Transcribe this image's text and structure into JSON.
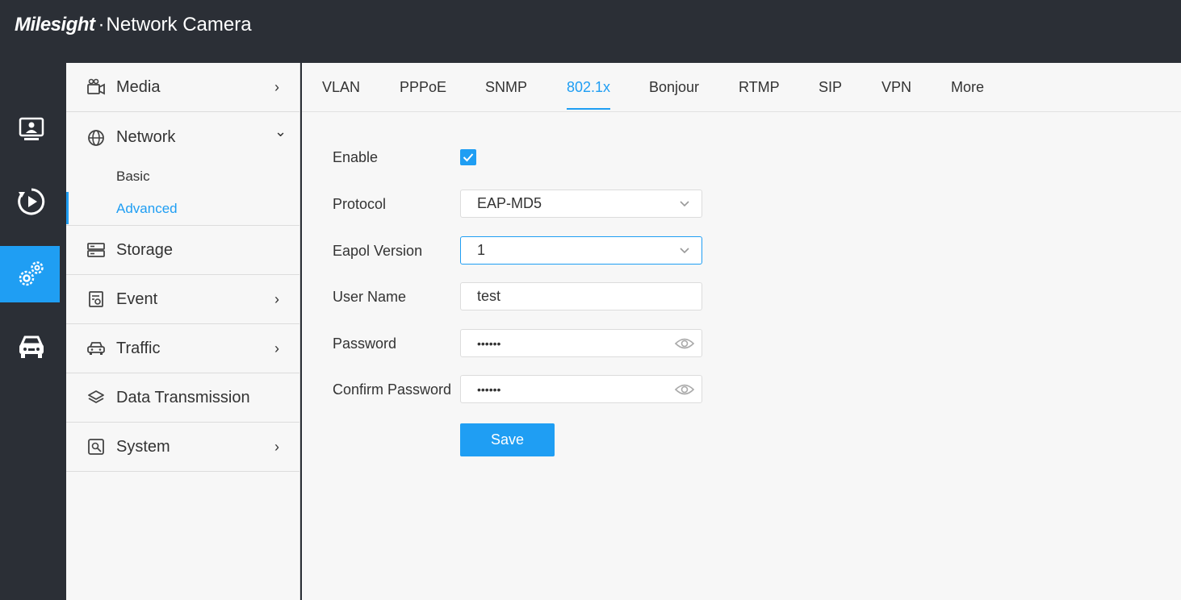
{
  "header": {
    "brand": "Milesight",
    "separator": "·",
    "product": "Network Camera"
  },
  "rail": {
    "items": [
      {
        "icon": "live-view-icon",
        "active": false
      },
      {
        "icon": "playback-icon",
        "active": false
      },
      {
        "icon": "settings-icon",
        "active": true
      },
      {
        "icon": "vehicle-icon",
        "active": false
      }
    ]
  },
  "sidebar": {
    "items": [
      {
        "label": "Media",
        "icon": "camera-icon",
        "chevron": "›"
      },
      {
        "label": "Network",
        "icon": "globe-icon",
        "chevron": "⌄",
        "children": [
          {
            "label": "Basic"
          },
          {
            "label": "Advanced",
            "active": true
          }
        ]
      },
      {
        "label": "Storage",
        "icon": "storage-icon",
        "chevron": ""
      },
      {
        "label": "Event",
        "icon": "event-icon",
        "chevron": "›"
      },
      {
        "label": "Traffic",
        "icon": "car-icon",
        "chevron": "›"
      },
      {
        "label": "Data Transmission",
        "icon": "layers-icon",
        "chevron": ""
      },
      {
        "label": "System",
        "icon": "system-icon",
        "chevron": "›"
      }
    ]
  },
  "tabs": [
    {
      "label": "VLAN"
    },
    {
      "label": "PPPoE"
    },
    {
      "label": "SNMP"
    },
    {
      "label": "802.1x",
      "active": true
    },
    {
      "label": "Bonjour"
    },
    {
      "label": "RTMP"
    },
    {
      "label": "SIP"
    },
    {
      "label": "VPN"
    },
    {
      "label": "More"
    }
  ],
  "form": {
    "enable_label": "Enable",
    "enable_checked": true,
    "protocol_label": "Protocol",
    "protocol_value": "EAP-MD5",
    "eapol_label": "Eapol Version",
    "eapol_value": "1",
    "username_label": "User Name",
    "username_value": "test",
    "password_label": "Password",
    "password_value": "••••••",
    "confirm_label": "Confirm Password",
    "confirm_value": "••••••",
    "save_label": "Save"
  },
  "colors": {
    "accent": "#1f9ef3",
    "header_bg": "#2b2f36",
    "panel_bg": "#f7f7f7"
  }
}
